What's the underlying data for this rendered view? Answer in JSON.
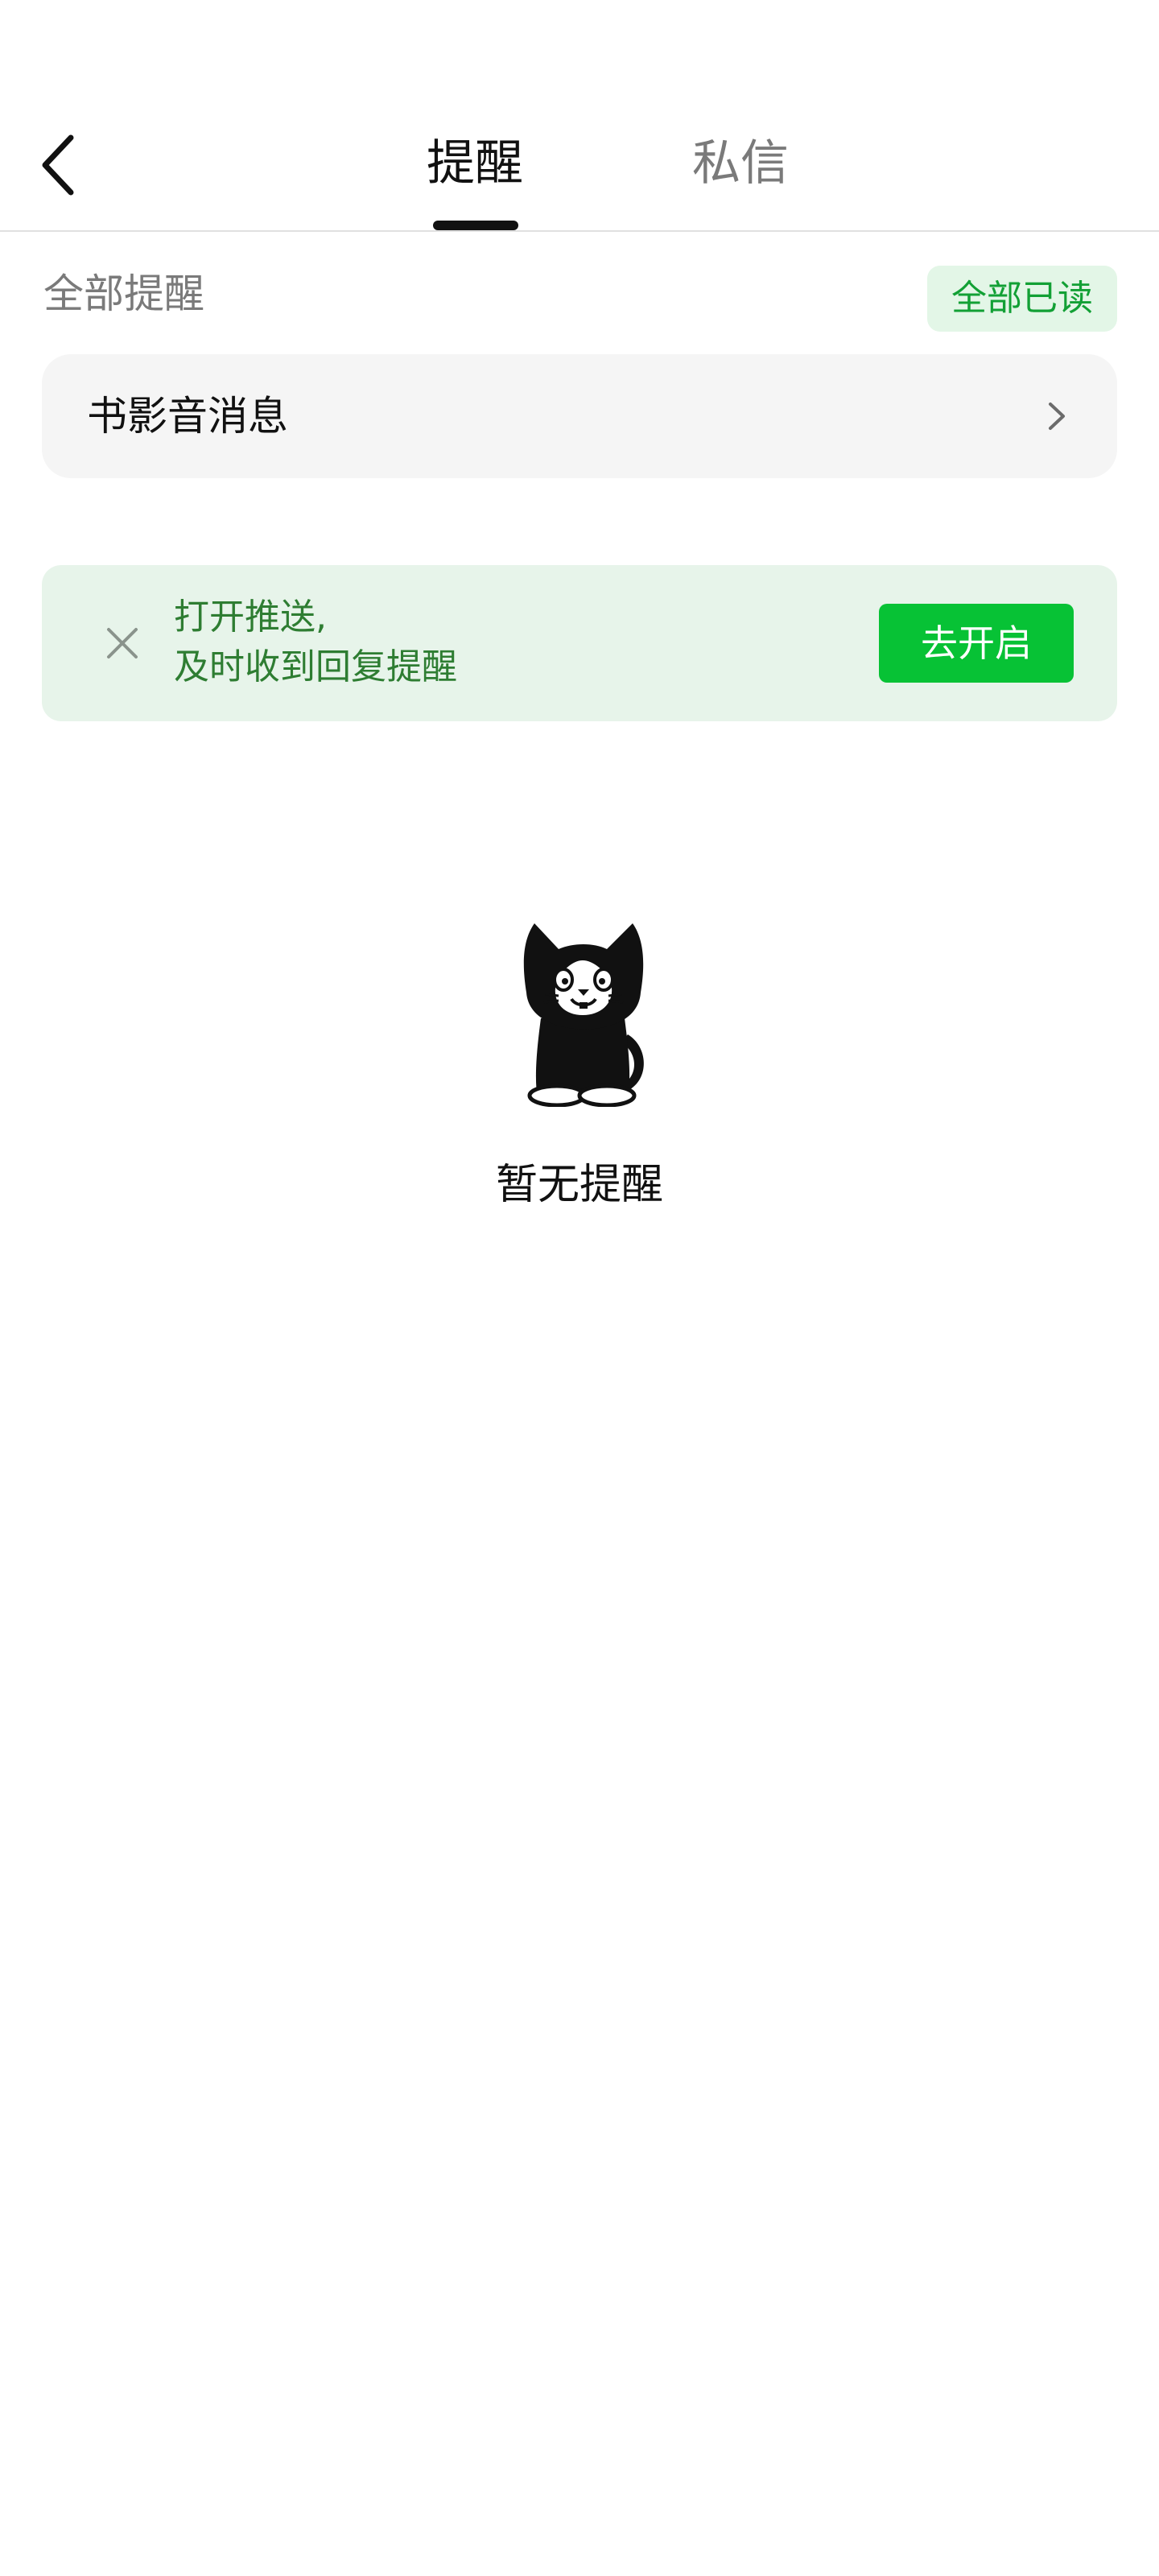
{
  "header": {
    "tabs": [
      {
        "label": "提醒",
        "active": true
      },
      {
        "label": "私信",
        "active": false
      }
    ]
  },
  "reminders": {
    "section_title": "全部提醒",
    "mark_all_read_label": "全部已读",
    "rows": [
      {
        "label": "书影音消息",
        "icon": "chevron-right-icon"
      }
    ]
  },
  "push_banner": {
    "line1": "打开推送,",
    "line2": "及时收到回复提醒",
    "button_label": "去开启",
    "close_icon": "close-icon"
  },
  "empty_state": {
    "message": "暂无提醒",
    "illustration": "cat-illustration"
  },
  "colors": {
    "accent": "#07c235",
    "accent_text": "#12a035",
    "banner_bg": "#e7f4ea",
    "row_bg": "#f5f5f5"
  }
}
